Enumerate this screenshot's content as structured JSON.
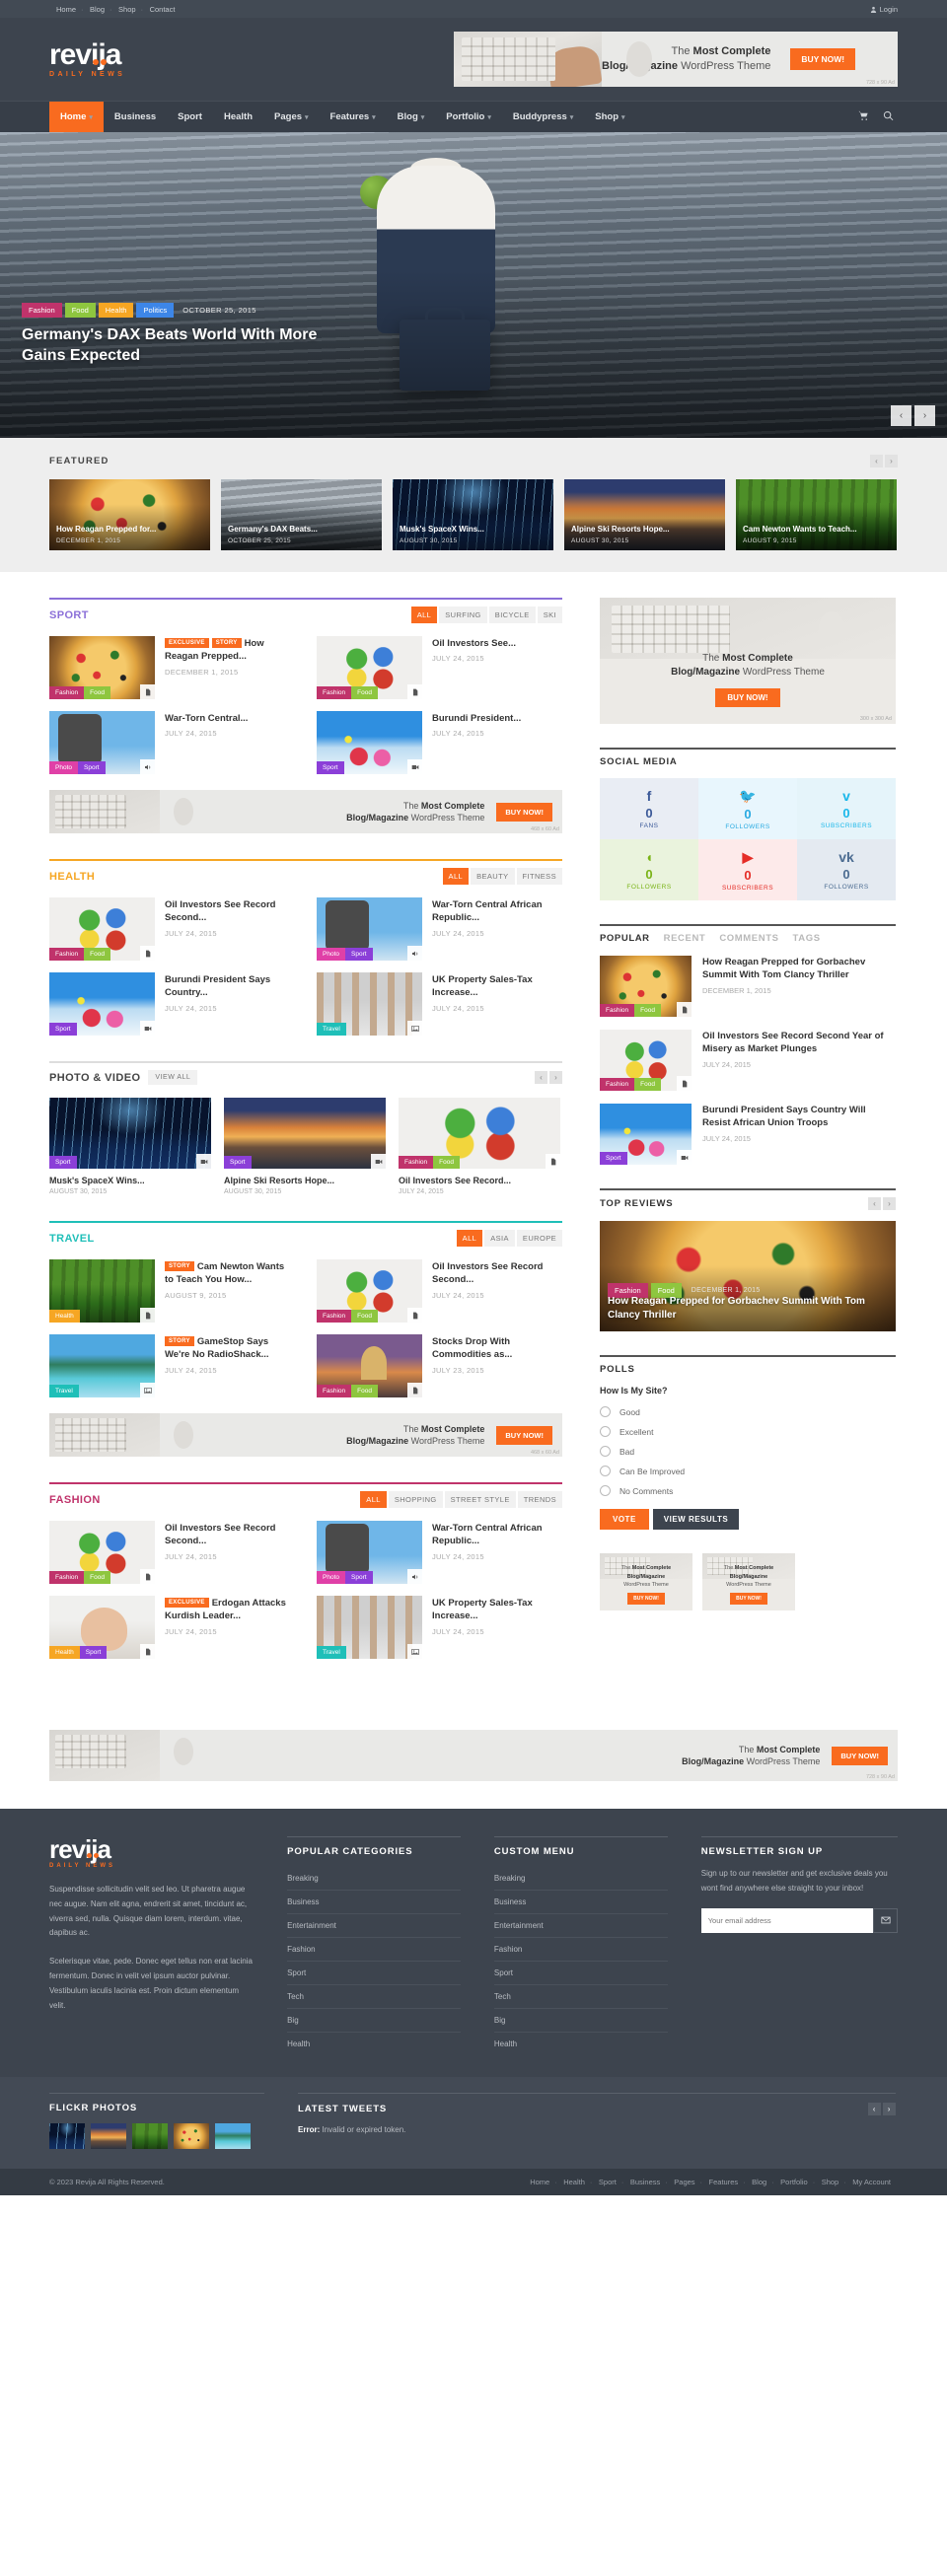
{
  "topbar": {
    "links": [
      "Home",
      "Blog",
      "Shop",
      "Contact"
    ],
    "login": "Login"
  },
  "brand": {
    "name": "revija",
    "tagline": "DAILY NEWS"
  },
  "header_ad": {
    "line1_pre": "The ",
    "line1_bold": "Most Complete",
    "line2_bold": "Blog/Magazine",
    "line2_post": " WordPress Theme",
    "button": "BUY NOW!",
    "size": "728 x 90 Ad"
  },
  "mainnav": {
    "items": [
      {
        "label": "Home",
        "caret": true,
        "active": true
      },
      {
        "label": "Business",
        "caret": false,
        "active": false
      },
      {
        "label": "Sport",
        "caret": false,
        "active": false
      },
      {
        "label": "Health",
        "caret": false,
        "active": false
      },
      {
        "label": "Pages",
        "caret": true,
        "active": false
      },
      {
        "label": "Features",
        "caret": true,
        "active": false
      },
      {
        "label": "Blog",
        "caret": true,
        "active": false
      },
      {
        "label": "Portfolio",
        "caret": true,
        "active": false
      },
      {
        "label": "Buddypress",
        "caret": true,
        "active": false
      },
      {
        "label": "Shop",
        "caret": true,
        "active": false
      }
    ],
    "cart_icon": "cart-icon",
    "search_icon": "search-icon"
  },
  "hero": {
    "categories": [
      {
        "label": "Fashion",
        "color": "#c0336b"
      },
      {
        "label": "Food",
        "color": "#8ec63f"
      },
      {
        "label": "Health",
        "color": "#f6a623"
      },
      {
        "label": "Politics",
        "color": "#3d86e8"
      }
    ],
    "date": "OCTOBER 25, 2015",
    "title": "Germany's DAX Beats World With More Gains Expected",
    "prev": "‹",
    "next": "›"
  },
  "featured": {
    "title": "FEATURED",
    "prev": "‹",
    "next": "›",
    "cards": [
      {
        "title": "How Reagan Prepped for...",
        "date": "DECEMBER 1, 2015",
        "art": "img-pizza"
      },
      {
        "title": "Germany's DAX Beats...",
        "date": "OCTOBER 25, 2015",
        "art": "img-train"
      },
      {
        "title": "Musk's SpaceX Wins...",
        "date": "AUGUST 30, 2015",
        "art": "img-bridge"
      },
      {
        "title": "Alpine Ski Resorts Hope...",
        "date": "AUGUST 30, 2015",
        "art": "img-sunset"
      },
      {
        "title": "Cam Newton Wants to Teach...",
        "date": "AUGUST 9, 2015",
        "art": "img-forest"
      }
    ]
  },
  "sections": {
    "sport": {
      "title": "SPORT",
      "color": "#8b6fd8",
      "filters": [
        "ALL",
        "SURFING",
        "BICYCLE",
        "SKI"
      ],
      "active_filter": "ALL",
      "posts": [
        {
          "tags": [
            "EXCLUSIVE",
            "STORY"
          ],
          "title": "How Reagan Prepped...",
          "date": "DECEMBER 1, 2015",
          "art": "img-pizza",
          "cats": [
            {
              "label": "Fashion",
              "cls": "fashion"
            },
            {
              "label": "Food",
              "cls": "food"
            }
          ],
          "fmt": "doc-icon"
        },
        {
          "tags": [],
          "title": "Oil Investors See...",
          "date": "JULY 24, 2015",
          "art": "img-puzzle",
          "cats": [
            {
              "label": "Fashion",
              "cls": "fashion"
            },
            {
              "label": "Food",
              "cls": "food"
            }
          ],
          "fmt": "doc-icon"
        },
        {
          "tags": [],
          "title": "War-Torn Central...",
          "date": "JULY 24, 2015",
          "art": "img-climb",
          "cats": [
            {
              "label": "Photo",
              "cls": "photo"
            },
            {
              "label": "Sport",
              "cls": "sport"
            }
          ],
          "fmt": "audio-icon"
        },
        {
          "tags": [],
          "title": "Burundi President...",
          "date": "JULY 24, 2015",
          "art": "img-ski",
          "cats": [
            {
              "label": "Sport",
              "cls": "sport"
            }
          ],
          "fmt": "video-icon"
        }
      ]
    },
    "health": {
      "title": "HEALTH",
      "color": "#f6a623",
      "filters": [
        "ALL",
        "BEAUTY",
        "FITNESS"
      ],
      "active_filter": "ALL",
      "posts": [
        {
          "tags": [],
          "title": "Oil Investors See Record Second...",
          "date": "JULY 24, 2015",
          "art": "img-puzzle",
          "cats": [
            {
              "label": "Fashion",
              "cls": "fashion"
            },
            {
              "label": "Food",
              "cls": "food"
            }
          ],
          "fmt": "doc-icon"
        },
        {
          "tags": [],
          "title": "War-Torn Central African Republic...",
          "date": "JULY 24, 2015",
          "art": "img-climb",
          "cats": [
            {
              "label": "Photo",
              "cls": "photo"
            },
            {
              "label": "Sport",
              "cls": "sport"
            }
          ],
          "fmt": "audio-icon"
        },
        {
          "tags": [],
          "title": "Burundi President Says Country...",
          "date": "JULY 24, 2015",
          "art": "img-ski",
          "cats": [
            {
              "label": "Sport",
              "cls": "sport"
            }
          ],
          "fmt": "video-icon"
        },
        {
          "tags": [],
          "title": "UK Property Sales-Tax Increase...",
          "date": "JULY 24, 2015",
          "art": "img-run",
          "cats": [
            {
              "label": "Travel",
              "cls": "travel"
            }
          ],
          "fmt": "image-icon"
        }
      ]
    },
    "photo_video": {
      "title": "PHOTO & VIDEO",
      "view_all": "VIEW ALL",
      "prev": "‹",
      "next": "›",
      "cards": [
        {
          "title": "Musk's SpaceX Wins...",
          "date": "AUGUST 30, 2015",
          "art": "img-bridge",
          "cats": [
            {
              "label": "Sport",
              "cls": "sport"
            }
          ],
          "fmt": "video-icon"
        },
        {
          "title": "Alpine Ski Resorts Hope...",
          "date": "AUGUST 30, 2015",
          "art": "img-sunset",
          "cats": [
            {
              "label": "Sport",
              "cls": "sport"
            }
          ],
          "fmt": "video-icon"
        },
        {
          "title": "Oil Investors See Record...",
          "date": "JULY 24, 2015",
          "art": "img-puzzle",
          "cats": [
            {
              "label": "Fashion",
              "cls": "fashion"
            },
            {
              "label": "Food",
              "cls": "food"
            }
          ],
          "fmt": "doc-icon"
        }
      ]
    },
    "travel": {
      "title": "TRAVEL",
      "color": "#1fbfb8",
      "filters": [
        "ALL",
        "ASIA",
        "EUROPE"
      ],
      "active_filter": "ALL",
      "posts": [
        {
          "tags": [
            "STORY"
          ],
          "title": "Cam Newton Wants to Teach You How...",
          "date": "AUGUST 9, 2015",
          "art": "img-forest",
          "cats": [
            {
              "label": "Health",
              "cls": "health"
            }
          ],
          "fmt": "doc-icon"
        },
        {
          "tags": [],
          "title": "Oil Investors See Record Second...",
          "date": "JULY 24, 2015",
          "art": "img-puzzle",
          "cats": [
            {
              "label": "Fashion",
              "cls": "fashion"
            },
            {
              "label": "Food",
              "cls": "food"
            }
          ],
          "fmt": "doc-icon"
        },
        {
          "tags": [
            "STORY"
          ],
          "title": "GameStop Says We're No RadioShack...",
          "date": "JULY 24, 2015",
          "art": "img-beach",
          "cats": [
            {
              "label": "Travel",
              "cls": "travel"
            }
          ],
          "fmt": "image-icon"
        },
        {
          "tags": [],
          "title": "Stocks Drop With Commodities as...",
          "date": "JULY 23, 2015",
          "art": "img-church",
          "cats": [
            {
              "label": "Fashion",
              "cls": "fashion"
            },
            {
              "label": "Food",
              "cls": "food"
            }
          ],
          "fmt": "doc-icon"
        }
      ]
    },
    "fashion": {
      "title": "FASHION",
      "color": "#c0336b",
      "filters": [
        "ALL",
        "SHOPPING",
        "STREET STYLE",
        "TRENDS"
      ],
      "active_filter": "ALL",
      "posts": [
        {
          "tags": [],
          "title": "Oil Investors See Record Second...",
          "date": "JULY 24, 2015",
          "art": "img-puzzle",
          "cats": [
            {
              "label": "Fashion",
              "cls": "fashion"
            },
            {
              "label": "Food",
              "cls": "food"
            }
          ],
          "fmt": "doc-icon"
        },
        {
          "tags": [],
          "title": "War-Torn Central African Republic...",
          "date": "JULY 24, 2015",
          "art": "img-climb",
          "cats": [
            {
              "label": "Photo",
              "cls": "photo"
            },
            {
              "label": "Sport",
              "cls": "sport"
            }
          ],
          "fmt": "audio-icon"
        },
        {
          "tags": [
            "EXCLUSIVE"
          ],
          "title": "Erdogan Attacks Kurdish Leader...",
          "date": "JULY 24, 2015",
          "art": "img-face",
          "cats": [
            {
              "label": "Health",
              "cls": "health"
            },
            {
              "label": "Sport",
              "cls": "sport"
            }
          ],
          "fmt": "doc-icon"
        },
        {
          "tags": [],
          "title": "UK Property Sales-Tax Increase...",
          "date": "JULY 24, 2015",
          "art": "img-run",
          "cats": [
            {
              "label": "Travel",
              "cls": "travel"
            }
          ],
          "fmt": "image-icon"
        }
      ]
    }
  },
  "inline_ads": {
    "line1_pre": "The ",
    "line1_bold": "Most Complete",
    "line2_bold": "Blog/Magazine",
    "line2_post": " WordPress Theme",
    "button": "BUY NOW!",
    "size_728": "728 x 90 Ad",
    "size_468": "468 x 60 Ad"
  },
  "sidebar": {
    "ad": {
      "line1_pre": "The ",
      "line1_bold": "Most Complete",
      "line2_bold": "Blog/Magazine",
      "line2_post": " WordPress Theme",
      "button": "BUY NOW!",
      "size": "300 x 300 Ad"
    },
    "social": {
      "title": "SOCIAL MEDIA",
      "items": [
        {
          "icon": "facebook-icon",
          "glyph": "f",
          "count": "0",
          "label": "FANS",
          "cls": "fb"
        },
        {
          "icon": "twitter-icon",
          "glyph": "🐦",
          "count": "0",
          "label": "FOLLOWERS",
          "cls": "tw"
        },
        {
          "icon": "vimeo-icon",
          "glyph": "v",
          "count": "0",
          "label": "SUBSCRIBERS",
          "cls": "vm"
        },
        {
          "icon": "dribbble-icon",
          "glyph": "◖",
          "count": "0",
          "label": "FOLLOWERS",
          "cls": "dr"
        },
        {
          "icon": "youtube-icon",
          "glyph": "▶",
          "count": "0",
          "label": "SUBSCRIBERS",
          "cls": "yt"
        },
        {
          "icon": "vk-icon",
          "glyph": "vk",
          "count": "0",
          "label": "FOLLOWERS",
          "cls": "vk"
        }
      ]
    },
    "tabs": {
      "items": [
        "POPULAR",
        "RECENT",
        "COMMENTS",
        "TAGS"
      ],
      "active": "POPULAR",
      "posts": [
        {
          "title": "How Reagan Prepped for Gorbachev Summit With Tom Clancy Thriller",
          "date": "DECEMBER 1, 2015",
          "art": "img-pizza",
          "cats": [
            {
              "label": "Fashion",
              "cls": "fashion"
            },
            {
              "label": "Food",
              "cls": "food"
            }
          ],
          "fmt": "doc-icon"
        },
        {
          "title": "Oil Investors See Record Second Year of Misery as Market Plunges",
          "date": "JULY 24, 2015",
          "art": "img-puzzle",
          "cats": [
            {
              "label": "Fashion",
              "cls": "fashion"
            },
            {
              "label": "Food",
              "cls": "food"
            }
          ],
          "fmt": "doc-icon"
        },
        {
          "title": "Burundi President Says Country Will Resist African Union Troops",
          "date": "JULY 24, 2015",
          "art": "img-ski",
          "cats": [
            {
              "label": "Sport",
              "cls": "sport"
            }
          ],
          "fmt": "video-icon"
        }
      ]
    },
    "top_reviews": {
      "title": "TOP REVIEWS",
      "prev": "‹",
      "next": "›",
      "cats": [
        {
          "label": "Fashion",
          "cls": "fashion"
        },
        {
          "label": "Food",
          "cls": "food"
        }
      ],
      "date": "DECEMBER 1, 2015",
      "headline": "How Reagan Prepped for Gorbachev Summit With Tom Clancy Thriller"
    },
    "polls": {
      "title": "POLLS",
      "question": "How Is My Site?",
      "options": [
        "Good",
        "Excellent",
        "Bad",
        "Can Be Improved",
        "No Comments"
      ],
      "vote_label": "VOTE",
      "results_label": "VIEW RESULTS"
    },
    "mini_ads": [
      {
        "line1_pre": "The ",
        "line1_bold": "Most Complete",
        "line2_bold": "Blog/Magazine",
        "line2_post": " WordPress Theme",
        "button": "BUY NOW!"
      },
      {
        "line1_pre": "The ",
        "line1_bold": "Most Complete",
        "line2_bold": "Blog/Magazine",
        "line2_post": " WordPress Theme",
        "button": "BUY NOW!"
      }
    ]
  },
  "footer": {
    "about_p1": "Suspendisse sollicitudin velit sed leo. Ut pharetra augue nec augue. Nam elit agna, endrerit sit amet, tincidunt ac, viverra sed, nulla. Quisque diam lorem, interdum. vitae, dapibus ac.",
    "about_p2": "Scelerisque vitae, pede. Donec eget tellus non erat lacinia fermentum. Donec in velit vel ipsum auctor\npulvinar. Vestibulum iaculis lacinia est. Proin dictum elementum velit.",
    "popular_title": "POPULAR CATEGORIES",
    "popular_items": [
      "Breaking",
      "Business",
      "Entertainment",
      "Fashion",
      "Sport",
      "Tech",
      "Big",
      "Health"
    ],
    "custom_title": "CUSTOM MENU",
    "custom_items": [
      "Breaking",
      "Business",
      "Entertainment",
      "Fashion",
      "Sport",
      "Tech",
      "Big",
      "Health"
    ],
    "newsletter_title": "NEWSLETTER SIGN UP",
    "newsletter_text": "Sign up to our newsletter and get exclusive deals you wont find anywhere else straight to your inbox!",
    "newsletter_placeholder": "Your email address",
    "flickr_title": "FLICKR PHOTOS",
    "tweets_title": "LATEST TWEETS",
    "tweets_prev": "‹",
    "tweets_next": "›",
    "tweets_error_label": "Error:",
    "tweets_error_text": " Invalid or expired token.",
    "copyright": "© 2023 Revija All Rights Reserved.",
    "bottom_links": [
      "Home",
      "Health",
      "Sport",
      "Business",
      "Pages",
      "Features",
      "Blog",
      "Portfolio",
      "Shop",
      "My Account"
    ]
  },
  "colors": {
    "accent": "#f96b1f",
    "dark": "#3d444e",
    "darker": "#343b44"
  }
}
